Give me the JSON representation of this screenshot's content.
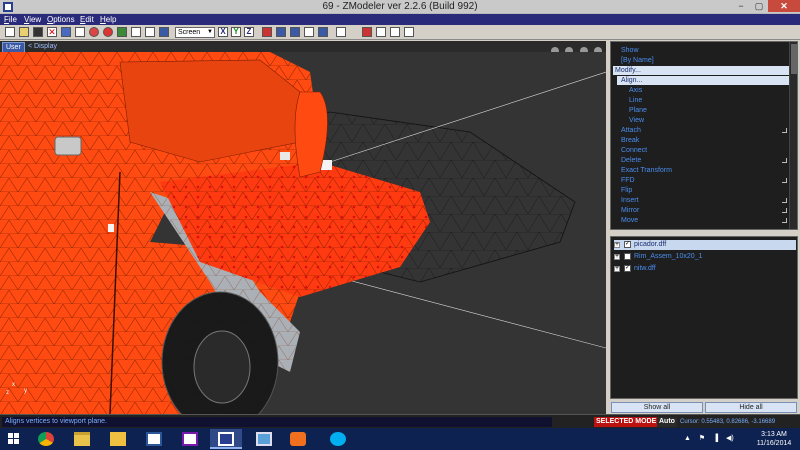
{
  "window": {
    "title": "69 - ZModeler ver 2.2.6 (Build 992)",
    "minimize": "−",
    "maximize": "▢",
    "close": "✕"
  },
  "menu": [
    "File",
    "View",
    "Options",
    "Edit",
    "Help"
  ],
  "toolbar": {
    "mode_select": "Screen",
    "accent": "#2a2a7a"
  },
  "viewport": {
    "tab_user": "User",
    "tab_display": "< Display",
    "axis_labels": [
      "x",
      "y",
      "z"
    ]
  },
  "commands": [
    {
      "label": "Show",
      "level": 0
    },
    {
      "label": "[By Name]",
      "level": 0
    },
    {
      "label": "Modify...",
      "level": 0,
      "selected": true
    },
    {
      "label": "Align...",
      "level": 1,
      "selected": true
    },
    {
      "label": "Axis",
      "level": 2
    },
    {
      "label": "Line",
      "level": 2
    },
    {
      "label": "Plane",
      "level": 2
    },
    {
      "label": "View",
      "level": 2
    },
    {
      "label": "Attach",
      "level": 0,
      "submenu": true
    },
    {
      "label": "Break",
      "level": 0
    },
    {
      "label": "Connect",
      "level": 0
    },
    {
      "label": "Delete",
      "level": 0,
      "submenu": true
    },
    {
      "label": "Exact Transform",
      "level": 0
    },
    {
      "label": "FFD",
      "level": 0,
      "submenu": true
    },
    {
      "label": "Flip",
      "level": 0
    },
    {
      "label": "Insert",
      "level": 0,
      "submenu": true
    },
    {
      "label": "Mirror",
      "level": 0,
      "submenu": true
    },
    {
      "label": "Move",
      "level": 0,
      "submenu": true
    }
  ],
  "objects": [
    {
      "name": "picador.dff",
      "checked": true,
      "selected": true
    },
    {
      "name": "Rim_Assem_10x20_1",
      "checked": false,
      "selected": false
    },
    {
      "name": "nitw.dff",
      "checked": true,
      "selected": false
    }
  ],
  "panel_buttons": {
    "show_all": "Show all",
    "hide_all": "Hide all"
  },
  "status": {
    "hint": "Aligns vertices to viewport plane.",
    "selected_mode": "SELECTED MODE",
    "auto": "Auto",
    "cursor": "Cursor: 0.55483, 0.82686, -3.16689"
  },
  "taskbar": {
    "time": "3:13 AM",
    "date": "11/16/2014",
    "apps": [
      "chrome",
      "file-explorer",
      "outlook",
      "word",
      "onenote",
      "zmodeler",
      "photos",
      "media-player",
      "skype"
    ]
  }
}
